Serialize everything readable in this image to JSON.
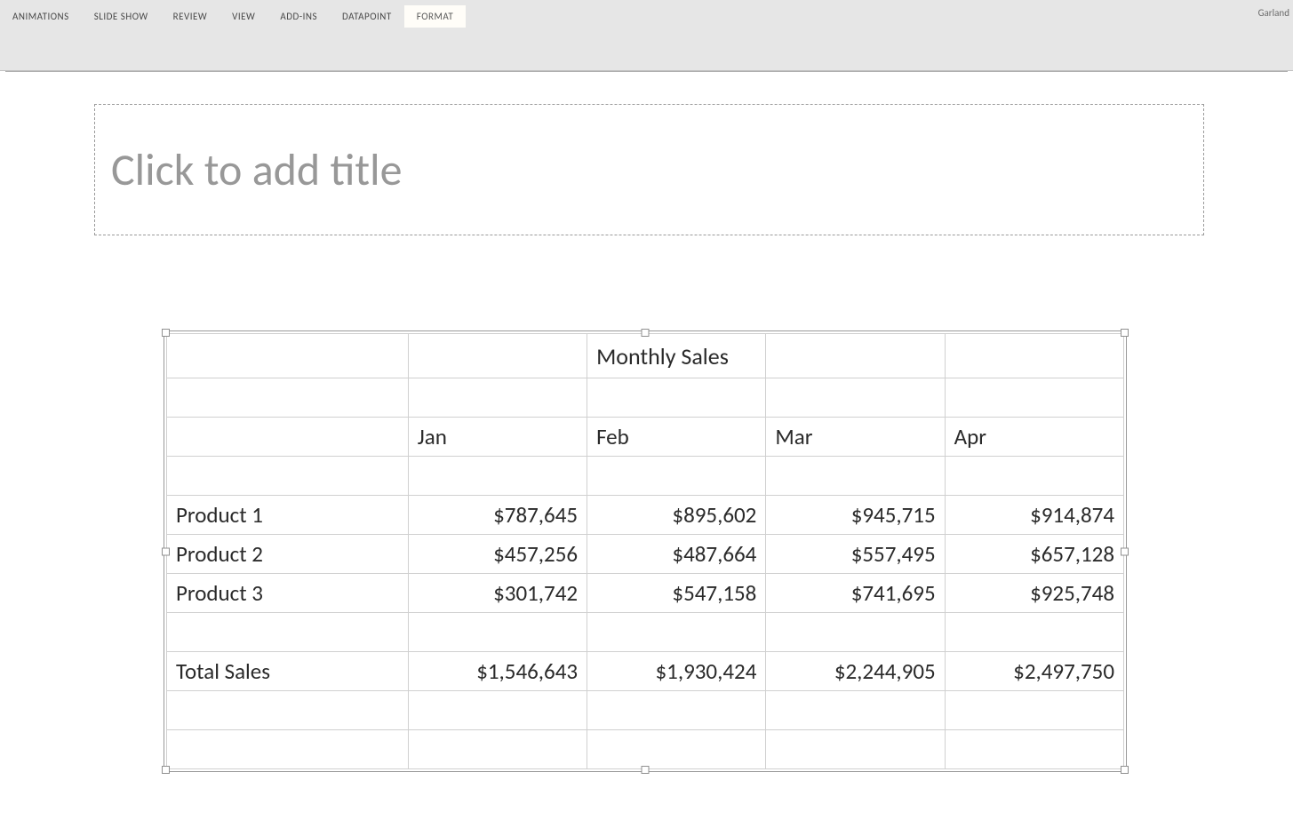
{
  "ribbon": {
    "tabs": [
      {
        "label": "ANIMATIONS",
        "active": false
      },
      {
        "label": "SLIDE SHOW",
        "active": false
      },
      {
        "label": "REVIEW",
        "active": false
      },
      {
        "label": "VIEW",
        "active": false
      },
      {
        "label": "ADD-INS",
        "active": false
      },
      {
        "label": "DATAPOINT",
        "active": false
      },
      {
        "label": "FORMAT",
        "active": true
      }
    ],
    "user": "Garland"
  },
  "slide": {
    "title_placeholder": "Click to add title"
  },
  "table": {
    "title": "Monthly Sales",
    "columns": [
      "Jan",
      "Feb",
      "Mar",
      "Apr"
    ],
    "rows": [
      {
        "label": "Product 1",
        "values": [
          "$787,645",
          "$895,602",
          "$945,715",
          "$914,874"
        ]
      },
      {
        "label": "Product 2",
        "values": [
          "$457,256",
          "$487,664",
          "$557,495",
          "$657,128"
        ]
      },
      {
        "label": "Product 3",
        "values": [
          "$301,742",
          "$547,158",
          "$741,695",
          "$925,748"
        ]
      }
    ],
    "total": {
      "label": "Total Sales",
      "values": [
        "$1,546,643",
        "$1,930,424",
        "$2,244,905",
        "$2,497,750"
      ]
    }
  },
  "chart_data": {
    "type": "table",
    "title": "Monthly Sales",
    "categories": [
      "Jan",
      "Feb",
      "Mar",
      "Apr"
    ],
    "series": [
      {
        "name": "Product 1",
        "values": [
          787645,
          895602,
          945715,
          914874
        ]
      },
      {
        "name": "Product 2",
        "values": [
          457256,
          487664,
          557495,
          657128
        ]
      },
      {
        "name": "Product 3",
        "values": [
          301742,
          547158,
          741695,
          925748
        ]
      },
      {
        "name": "Total Sales",
        "values": [
          1546643,
          1930424,
          2244905,
          2497750
        ]
      }
    ]
  }
}
